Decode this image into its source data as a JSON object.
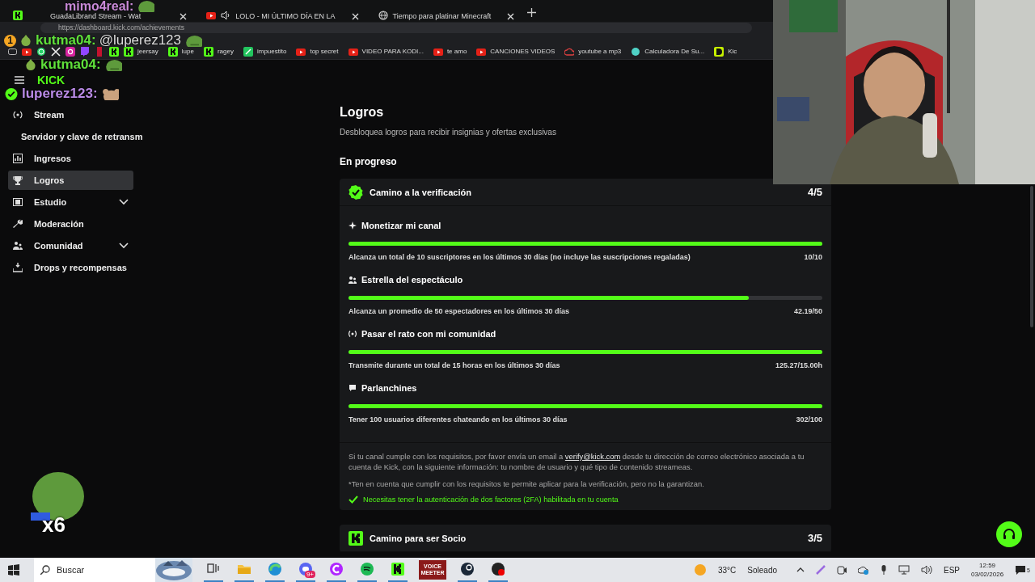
{
  "browser": {
    "tabs": [
      {
        "title": "GuadaLibrand Stream - Wat",
        "audio": false,
        "kind": "kick"
      },
      {
        "title": "LOLO - MI ÚLTIMO DÍA EN LA",
        "audio": true,
        "kind": "youtube"
      },
      {
        "title": "Tiempo para platinar Minecraft",
        "audio": false,
        "kind": "globe"
      }
    ],
    "address": "https://dashboard.kick.com/achievements",
    "bookmarks": [
      {
        "kind": "youtube"
      },
      {
        "kind": "whatsapp"
      },
      {
        "kind": "x"
      },
      {
        "kind": "instagram"
      },
      {
        "kind": "twitch"
      },
      {
        "kind": "red"
      },
      {
        "kind": "kick"
      },
      {
        "kind": "kick",
        "label": "jeersay"
      },
      {
        "kind": "kick",
        "label": "lupe"
      },
      {
        "kind": "kick",
        "label": "ragey"
      },
      {
        "kind": "sheet",
        "label": "impuestito"
      },
      {
        "kind": "youtube",
        "label": "top secret"
      },
      {
        "kind": "youtube",
        "label": "VIDEO PARA KODI..."
      },
      {
        "kind": "youtube",
        "label": "te amo"
      },
      {
        "kind": "youtube",
        "label": "CANCIONES VIDEOS"
      },
      {
        "kind": "cloud",
        "label": "youtube a mp3"
      },
      {
        "kind": "calc",
        "label": "Calculadora De Su..."
      },
      {
        "kind": "d",
        "label": "Kic"
      }
    ]
  },
  "sidebar": {
    "items": [
      {
        "label": "Stream",
        "kind": "stream",
        "selected": false,
        "expandable": false
      },
      {
        "label": "Servidor y clave de retransm",
        "selected": false,
        "expandable": false
      },
      {
        "label": "Ingresos",
        "kind": "income",
        "selected": false,
        "expandable": false
      },
      {
        "label": "Logros",
        "kind": "trophy",
        "selected": true,
        "expandable": false
      },
      {
        "label": "Estudio",
        "kind": "studio",
        "selected": false,
        "expandable": true
      },
      {
        "label": "Moderación",
        "kind": "wrench",
        "selected": false,
        "expandable": false
      },
      {
        "label": "Comunidad",
        "kind": "community",
        "selected": false,
        "expandable": true
      },
      {
        "label": "Drops y recompensas",
        "kind": "drops",
        "selected": false,
        "expandable": false
      }
    ]
  },
  "main": {
    "title": "Logros",
    "subtitle": "Desbloquea logros para recibir insignias y ofertas exclusivas",
    "section": "En progreso",
    "cards": [
      {
        "kind": "verified",
        "title": "Camino a la verificación",
        "score": "4/5",
        "tasks": [
          {
            "kind": "sparkle",
            "title": "Monetizar mi canal",
            "description": "Alcanza un total de 10 suscriptores en los últimos 30 días (no incluye las suscripciones regaladas)",
            "reading": "10/10",
            "level": 1
          },
          {
            "kind": "people",
            "title": "Estrella del espectáculo",
            "description": "Alcanza un promedio de 50 espectadores en los últimos 30 días",
            "reading": "42.19/50",
            "level": 0.844
          },
          {
            "kind": "broadcast",
            "title": "Pasar el rato con mi comunidad",
            "description": "Transmite durante un total de 15 horas en los últimos 30 días",
            "reading": "125.27/15.00h",
            "level": 1
          },
          {
            "kind": "chat",
            "title": "Parlanchines",
            "description": "Tener 100 usuarios diferentes chateando en los últimos 30 días",
            "reading": "302/100",
            "level": 1
          }
        ],
        "info": {
          "before": "Si tu canal cumple con los requisitos, por favor envía un email a ",
          "link": "verify@kick.com",
          "after": " desde tu dirección de correo electrónico asociada a tu cuenta de Kick, con la siguiente información: tu nombre de usuario y qué tipo de contenido streameas.",
          "note": "*Ten en cuenta que cumplir con los requisitos te permite aplicar para la verificación, pero no la garantizan.",
          "requirement": "Necesitas tener la autenticación de dos factores (2FA) habilitada en tu cuenta",
          "requirement_met": true
        }
      },
      {
        "kind": "kick",
        "title": "Camino para ser Socio",
        "score": "3/5"
      }
    ]
  },
  "chat_overlay": {
    "messages": [
      {
        "user": "mimo4real:",
        "color": "#c98ad8",
        "verified": false
      },
      {
        "user": "kutma04:",
        "color": "#5fe03a",
        "text": "@luperez123",
        "badge": "1",
        "verified": false
      },
      {
        "user": "kutma04:",
        "color": "#5fe03a",
        "logo": "KICK",
        "verified": false
      },
      {
        "user": "luperez123:",
        "color": "#b98ae6",
        "verified": true
      }
    ],
    "combo": "x6"
  },
  "taskbar": {
    "search_placeholder": "Buscar",
    "apps": [
      {
        "kind": "taskview"
      },
      {
        "kind": "folder"
      },
      {
        "kind": "edge"
      },
      {
        "kind": "discord",
        "badge": "9+"
      },
      {
        "kind": "c"
      },
      {
        "kind": "spotify"
      },
      {
        "kind": "kick"
      },
      {
        "kind": "voicemeeter",
        "label": "VOICE MEETER"
      },
      {
        "kind": "steam"
      },
      {
        "kind": "obs"
      }
    ],
    "temperature": "33°C",
    "weather": "Soleado",
    "language": "ESP",
    "time": "12:59",
    "date": "03/02/2026",
    "notifications": "5"
  }
}
